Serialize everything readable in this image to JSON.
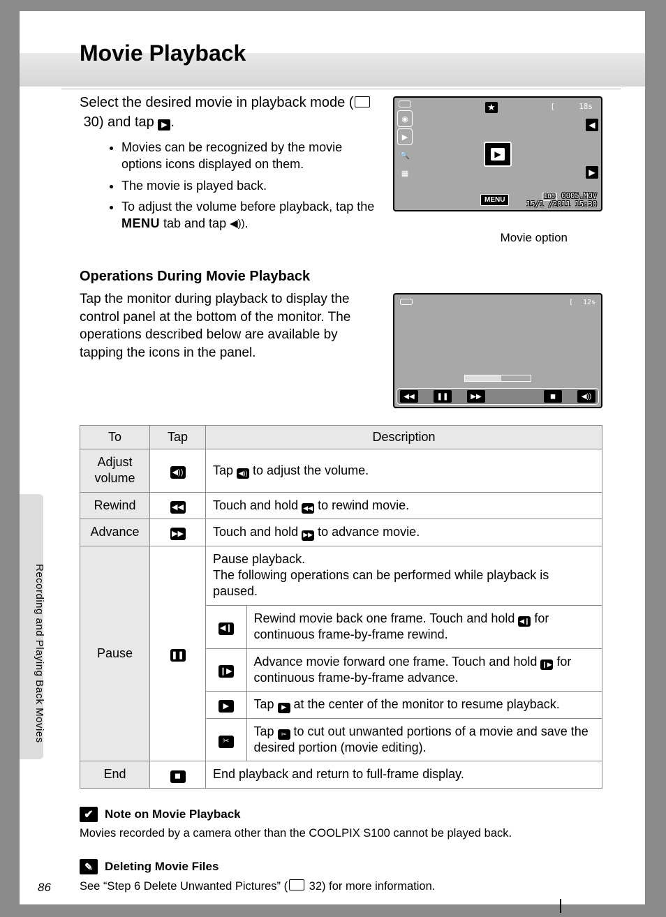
{
  "title": "Movie Playback",
  "intro": {
    "line1a": "Select the desired movie in playback mode (",
    "page_ref": "30",
    "line1b": ") and tap ",
    "line1c": "."
  },
  "bullets": [
    "Movies can be recognized by the movie options icons displayed on them.",
    "The movie is played back.",
    "To adjust the volume before playback, tap the "
  ],
  "bullet3_tail": " tab and tap ",
  "menu_word": "MENU",
  "screen1": {
    "time": "18s",
    "brk": "[",
    "file1": "0005.MOV",
    "file2": "15/1 /2011  15:30",
    "chip": "100",
    "menu": "MENU",
    "caption": "Movie option"
  },
  "h2": "Operations During Movie Playback",
  "para": "Tap the monitor during playback to display the control panel at the bottom of the monitor. The operations described below are available by tapping the icons in the panel.",
  "screen2": {
    "time": "12s",
    "brk": "["
  },
  "table": {
    "head": {
      "to": "To",
      "tap": "Tap",
      "desc": "Description"
    },
    "rows": {
      "vol": {
        "to": "Adjust volume",
        "desc_a": "Tap ",
        "desc_b": " to adjust the volume."
      },
      "rw": {
        "to": "Rewind",
        "desc_a": "Touch and hold ",
        "desc_b": " to rewind movie."
      },
      "adv": {
        "to": "Advance",
        "desc_a": "Touch and hold ",
        "desc_b": " to advance movie."
      },
      "pause": {
        "to": "Pause",
        "intro": "Pause playback.\nThe following operations can be performed while playback is paused.",
        "r1a": "Rewind movie back one frame. Touch and hold ",
        "r1b": " for continuous frame-by-frame rewind.",
        "r2a": "Advance movie forward one frame. Touch and hold ",
        "r2b": " for continuous frame-by-frame advance.",
        "r3a": "Tap ",
        "r3b": " at the center of the monitor to resume playback.",
        "r4a": "Tap ",
        "r4b": " to cut out unwanted portions of a movie and save the desired portion (movie editing)."
      },
      "end": {
        "to": "End",
        "desc": "End playback and return to full-frame display."
      }
    }
  },
  "side_label": "Recording and Playing Back Movies",
  "note1_title": "Note on Movie Playback",
  "note1_body": "Movies recorded by a camera other than the COOLPIX S100 cannot be played back.",
  "note2_title": "Deleting Movie Files",
  "note2_body_a": "See “Step 6 Delete Unwanted Pictures” (",
  "note2_page": "32",
  "note2_body_b": ") for more information.",
  "page_num": "86"
}
